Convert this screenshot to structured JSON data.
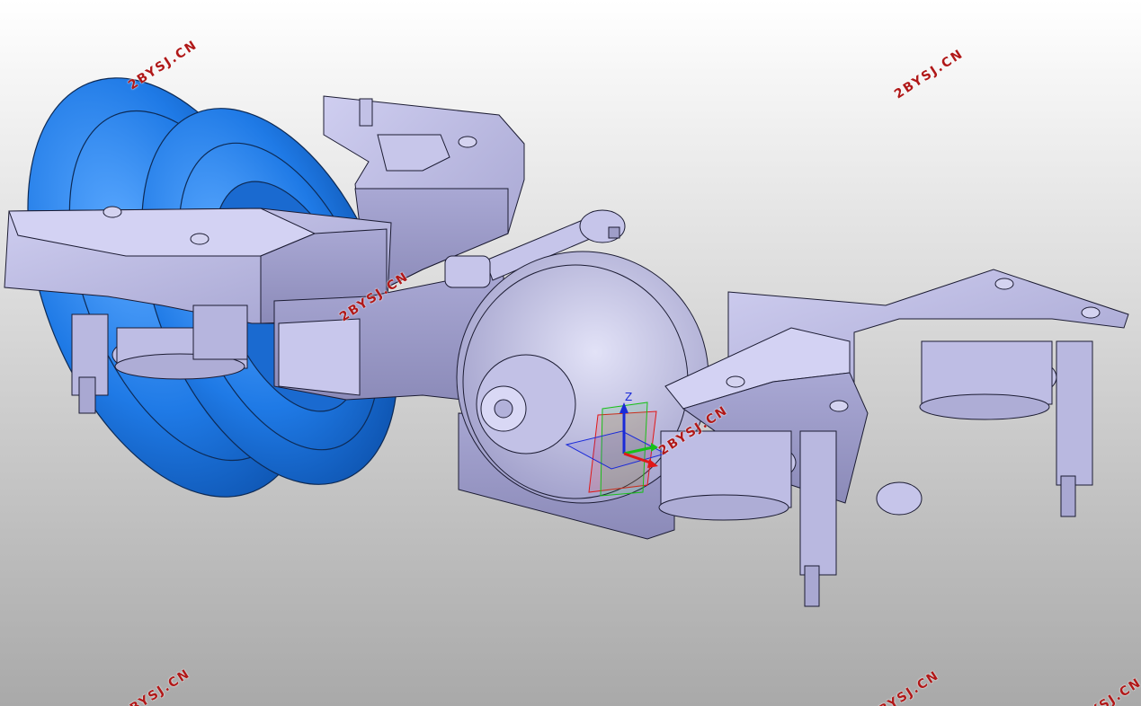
{
  "viewer": {
    "background_top": "#ffffff",
    "background_bottom": "#a9a9a9",
    "part_color": "#b9b8e2",
    "tire_color": "#1f7ae6",
    "edge_color": "#1c1c33"
  },
  "watermarks": [
    {
      "text": "2BYSJ.CN"
    },
    {
      "text": "2BYSJ.CN"
    },
    {
      "text": "2BYSJ.CN"
    },
    {
      "text": "2BYSJ.CN"
    },
    {
      "text": "2BYSJ.CN"
    },
    {
      "text": "2BYSJ.CN"
    },
    {
      "text": "2BYSJ.CN"
    }
  ],
  "compass": {
    "z_label": "Z",
    "x_color": "#e01818",
    "y_color": "#18c018",
    "z_color": "#1a2ad8"
  }
}
